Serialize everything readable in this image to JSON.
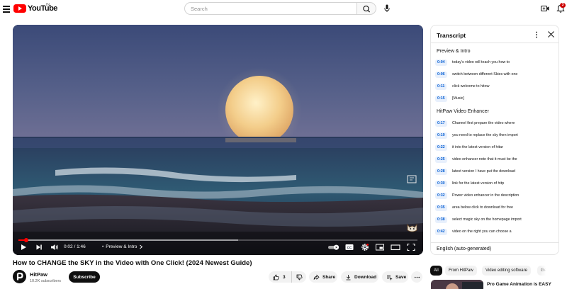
{
  "header": {
    "logo_text": "YouTube",
    "country_code": "IN",
    "search_placeholder": "Search",
    "notification_count": "3"
  },
  "player": {
    "time": "0:02 / 1:46",
    "chapter": "Preview & Intro",
    "progress_fraction": 0.019,
    "buffer_fraction": 0.55
  },
  "video": {
    "title": "How to CHANGE the SKY in the Video with One Click!   (2024 Newest Guide)",
    "channel_name": "HitPaw",
    "subscribers": "10.2K subscribers",
    "subscribe_label": "Subscribe",
    "like_count": "3",
    "share_label": "Share",
    "download_label": "Download",
    "save_label": "Save"
  },
  "transcript": {
    "title": "Transcript",
    "chapters": [
      {
        "title": "Preview & Intro",
        "segments": [
          {
            "time": "0:04",
            "text": "today's video will teach you how to"
          },
          {
            "time": "0:06",
            "text": "switch between different Skies with one"
          },
          {
            "time": "0:11",
            "text": "click welcome to hitow"
          },
          {
            "time": "0:15",
            "text": "[Music]"
          }
        ]
      },
      {
        "title": "HitPaw Video Enhancer",
        "segments": [
          {
            "time": "0:17",
            "text": "Channel first prepare the video where"
          },
          {
            "time": "0:19",
            "text": "you need to replace the sky then import"
          },
          {
            "time": "0:22",
            "text": "it into the latest version of hitar"
          },
          {
            "time": "0:25",
            "text": "video enhancer note that it must be the"
          },
          {
            "time": "0:28",
            "text": "latest version I have put the download"
          },
          {
            "time": "0:30",
            "text": "link for the latest version of hitp"
          },
          {
            "time": "0:32",
            "text": "Power video enhancer in the description"
          },
          {
            "time": "0:35",
            "text": "area below click to download for free"
          },
          {
            "time": "0:38",
            "text": "select magic sky on the homepage import"
          },
          {
            "time": "0:42",
            "text": "video on the right you can choose a"
          }
        ]
      }
    ],
    "language": "English (auto-generated)"
  },
  "chips": [
    "All",
    "From HitPaw",
    "Video editing software",
    "Ge"
  ],
  "recommendation": {
    "title": "Pro Game Animation is EASY"
  },
  "colors": {
    "brand_red": "#ff0000",
    "timestamp_blue": "#065fd4",
    "timestamp_bg": "#e8f0fc"
  }
}
